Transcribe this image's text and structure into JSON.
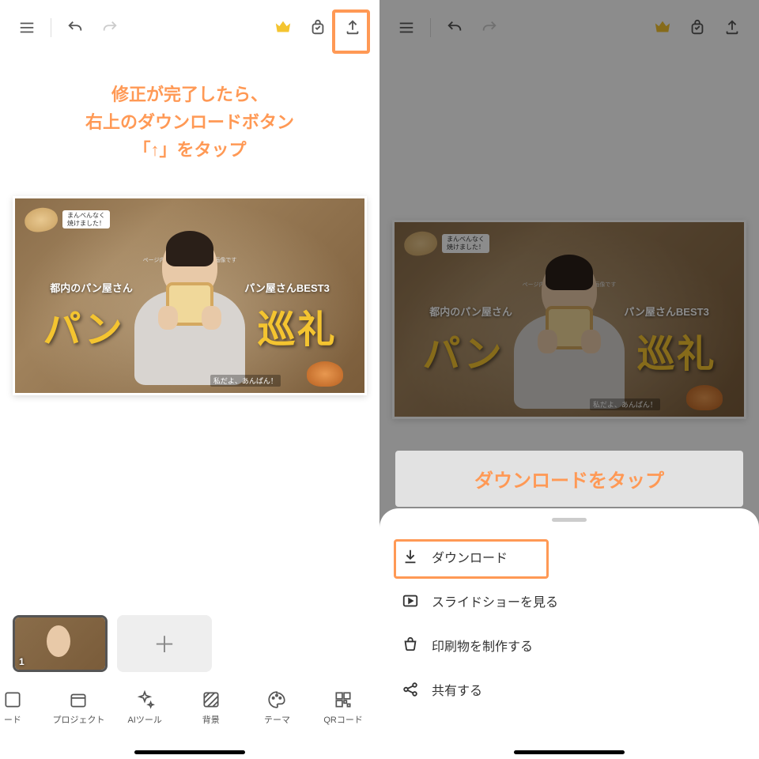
{
  "left": {
    "callout": {
      "line1": "修正が完了したら、",
      "line2": "右上のダウンロードボタン",
      "line3": "「↑」をタップ"
    },
    "canvas": {
      "badge_text": "まんべんなく\n焼けました！",
      "sub_left": "都内のパン屋さん",
      "sub_right": "パン屋さんBEST3",
      "title_left": "パン",
      "title_right": "巡礼",
      "note": "ページ内の人物等はサンプル画像です",
      "tag_bl": "私だよ、あんぱん！"
    },
    "thumb_number": "1",
    "bottom_tabs": {
      "cut": "ード",
      "project": "プロジェクト",
      "ai": "AIツール",
      "bg": "背景",
      "theme": "テーマ",
      "qr": "QRコード"
    }
  },
  "right": {
    "callout": "ダウンロードをタップ",
    "sheet": {
      "download": "ダウンロード",
      "slideshow": "スライドショーを見る",
      "print": "印刷物を制作する",
      "share": "共有する"
    }
  }
}
